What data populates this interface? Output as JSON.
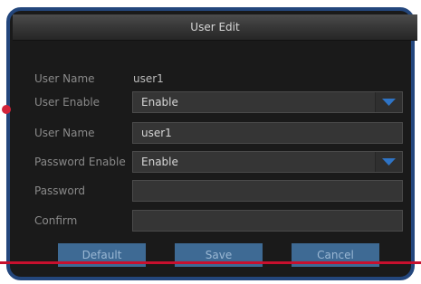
{
  "dialog": {
    "title": "User Edit"
  },
  "form": {
    "user_name_label": "User Name",
    "user_name_value": "user1",
    "user_enable_label": "User Enable",
    "user_enable_value": "Enable",
    "user_name_edit_label": "User Name",
    "user_name_edit_value": "user1",
    "password_enable_label": "Password Enable",
    "password_enable_value": "Enable",
    "password_label": "Password",
    "password_value": "",
    "confirm_label": "Confirm",
    "confirm_value": ""
  },
  "buttons": {
    "default_label": "Default",
    "save_label": "Save",
    "cancel_label": "Cancel"
  },
  "colors": {
    "frame_border": "#23467c",
    "dialog_bg": "#1a1a1a",
    "button_bg": "#3e6a94",
    "dropdown_arrow": "#2f74c5",
    "annotation_red": "#c8102e"
  },
  "icons": {
    "dropdown": "chevron-down-icon"
  }
}
